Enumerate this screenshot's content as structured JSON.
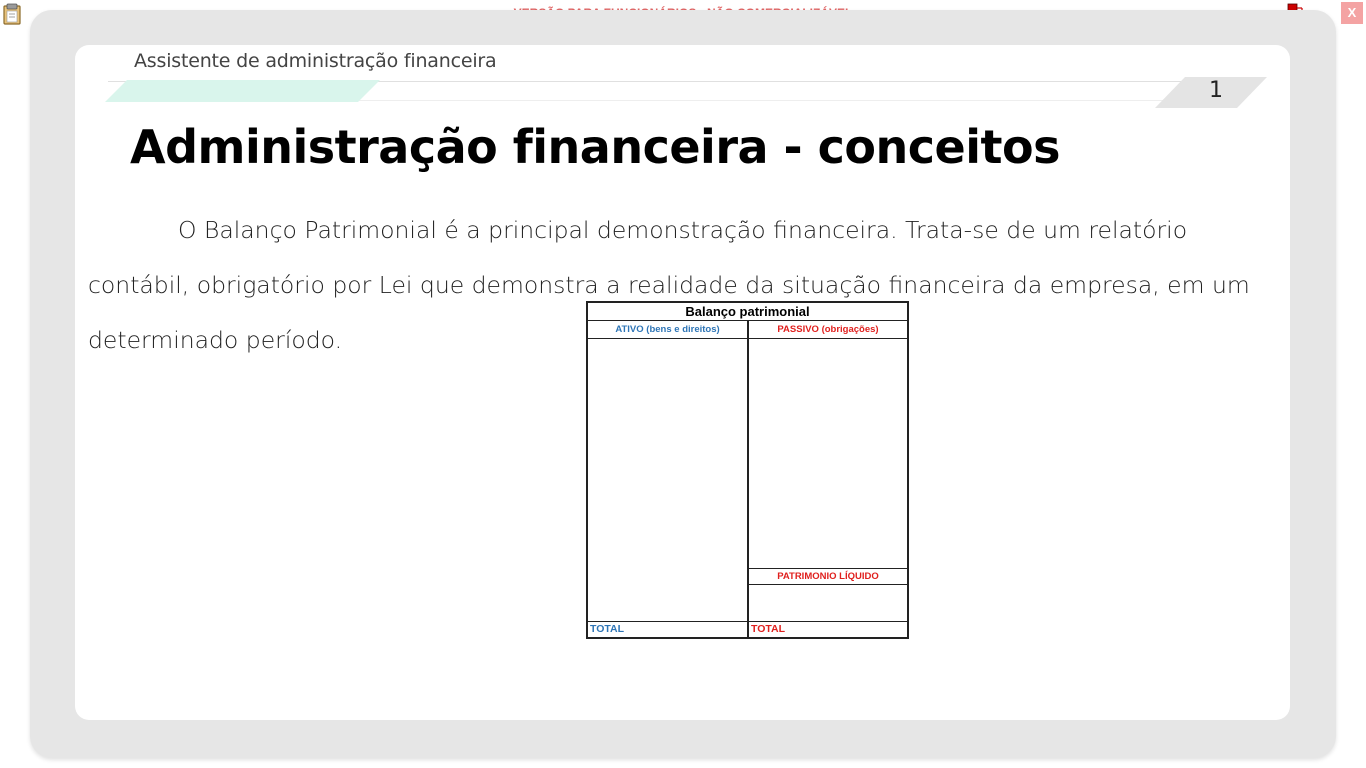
{
  "window": {
    "watermark": "VERSÃO PARA FUNCIONÁRIOS - NÃO COMERCIALIZÁVEL",
    "close_label": "X"
  },
  "header": {
    "course_title": "Assistente de administração financeira",
    "page_number": "1"
  },
  "slide": {
    "title": "Administração financeira - conceitos",
    "paragraph_lines": [
      "O Balanço Patrimonial é a principal demonstração financeira. Trata-se de um relatório",
      "contábil, obrigatório por Lei que demonstra a realidade da situação financeira da empresa, em um",
      "determinado período."
    ]
  },
  "balance_sheet": {
    "title": "Balanço patrimonial",
    "ativo_header": "ATIVO (bens e direitos)",
    "passivo_header": "PASSIVO (obrigações)",
    "pl_header": "PATRIMONIO LÍQUIDO",
    "total_left": "TOTAL",
    "total_right": "TOTAL"
  },
  "colors": {
    "ativo": "#2e75b6",
    "passivo": "#e0201e",
    "watermark": "#e06666",
    "mint": "#d9f5ec"
  },
  "icons": {
    "left": "clipboard-icon",
    "tray": "network-monitor-icon"
  }
}
